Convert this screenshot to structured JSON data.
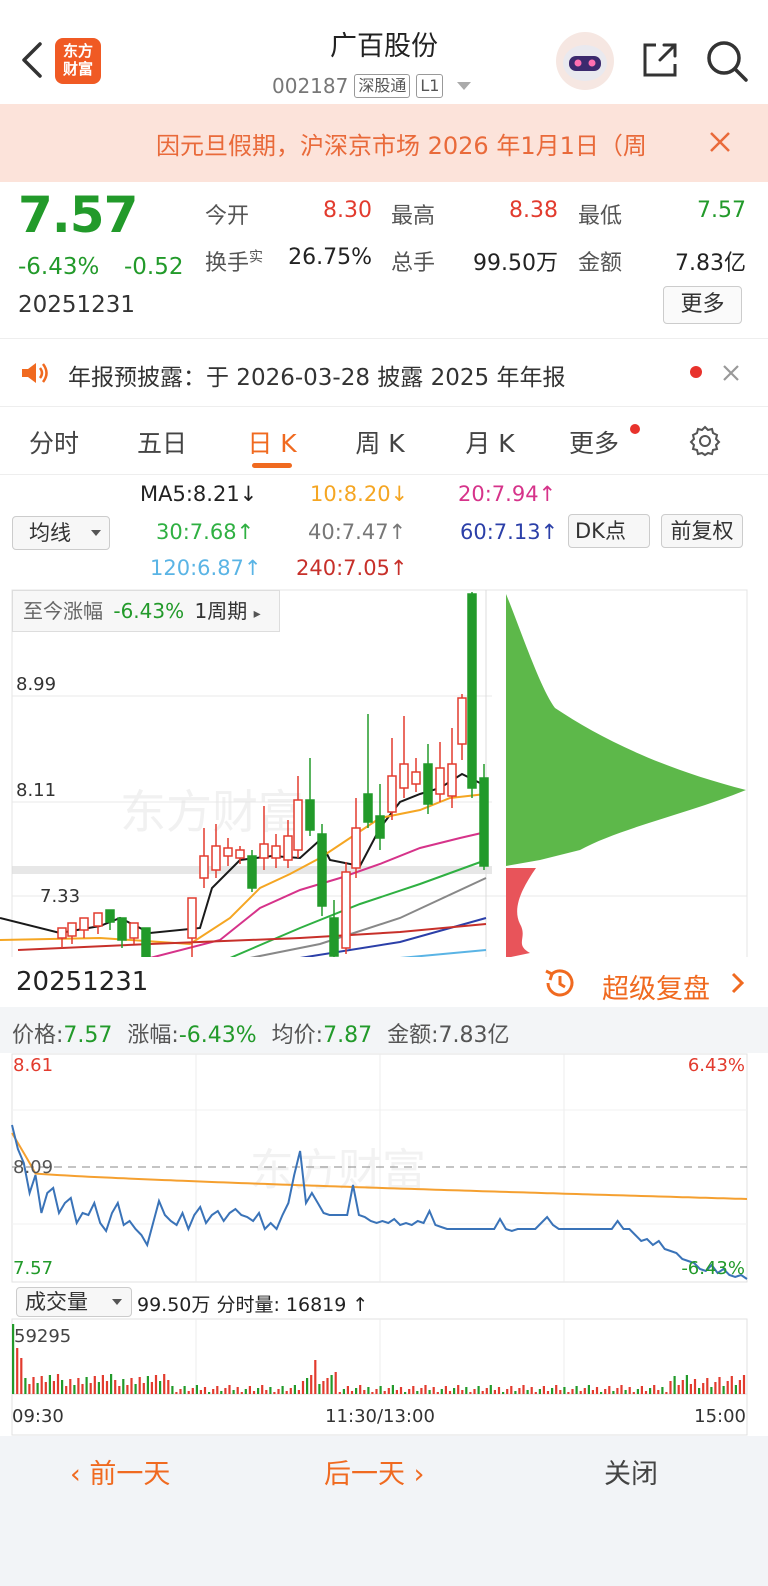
{
  "header": {
    "logo_text_line1": "东方",
    "logo_text_line2": "财富",
    "stock_name": "广百股份",
    "stock_code": "002187",
    "tag_connect": "深股通",
    "tag_level": "L1"
  },
  "notice": {
    "text": "因元旦假期，沪深京市场 2026 年1月1日（周"
  },
  "quote": {
    "price": "7.57",
    "change_pct": "-6.43%",
    "change_amt": "-0.52",
    "date": "20251231",
    "stats": [
      {
        "label": "今开",
        "value": "8.30",
        "color": "#e23b2e"
      },
      {
        "label": "最高",
        "value": "8.38",
        "color": "#e23b2e"
      },
      {
        "label": "最低",
        "value": "7.57",
        "color": "#229a2a"
      },
      {
        "label": "换手",
        "sup": "实",
        "value": "26.75%",
        "color": "#222222"
      },
      {
        "label": "总手",
        "value": "99.50万",
        "color": "#222222"
      },
      {
        "label": "金额",
        "value": "7.83亿",
        "color": "#222222"
      }
    ],
    "more_label": "更多"
  },
  "announcement": {
    "text": "年报预披露：于 2026-03-28 披露 2025 年年报"
  },
  "tabs": [
    {
      "label": "分时"
    },
    {
      "label": "五日"
    },
    {
      "label": "日 K"
    },
    {
      "label": "周 K"
    },
    {
      "label": "月 K"
    },
    {
      "label": "更多"
    }
  ],
  "ma_legend": {
    "selector": "均线",
    "ma5": "MA5:8.21↓",
    "ma10": "10:8.20↓",
    "ma20": "20:7.94↑",
    "ma30": "30:7.68↑",
    "ma40": "40:7.47↑",
    "ma60": "60:7.13↑",
    "ma120": "120:6.87↑",
    "ma240": "240:7.05↑",
    "dk_button": "DK点",
    "adjust_button": "前复权"
  },
  "kline": {
    "range_label": "至今涨幅",
    "range_value": "-6.43%",
    "range_period": "1周期",
    "y_labels": [
      "8.99",
      "8.11",
      "7.33"
    ],
    "watermark": "东方财富"
  },
  "replay": {
    "date": "20251231",
    "label": "超级复盘"
  },
  "intraday_info": {
    "price_label": "价格:",
    "price": "7.57",
    "chg_label": "涨幅:",
    "chg": "-6.43%",
    "avg_label": "均价:",
    "avg": "7.87",
    "amt_label": "金额:",
    "amt": "7.83亿"
  },
  "intraday": {
    "y_top": "8.61",
    "y_mid": "8.09",
    "y_bot": "7.57",
    "pct_top": "6.43%",
    "pct_bot": "-6.43%",
    "watermark": "东方财富"
  },
  "volume": {
    "selector": "成交量",
    "total": "99.50万",
    "minute_label": "分时量:",
    "minute_value": "16819",
    "minute_arrow": "↑",
    "max_label": "59295",
    "time_start": "09:30",
    "time_mid": "11:30/13:00",
    "time_end": "15:00"
  },
  "footer": {
    "prev": "前一天",
    "next": "后一天",
    "close": "关闭"
  },
  "colors": {
    "up": "#e23b2e",
    "down": "#229a2a",
    "accent": "#f06a20"
  }
}
